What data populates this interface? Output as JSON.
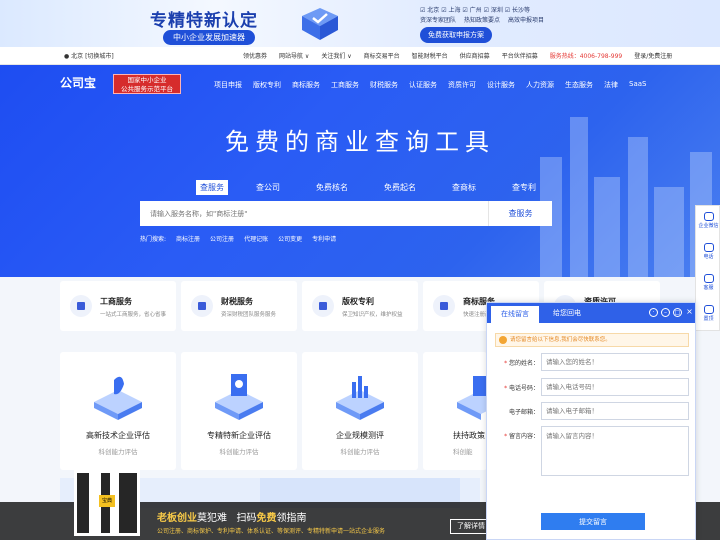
{
  "promo": {
    "title": "专精特新认定",
    "subtitle": "中小企业发展加速器",
    "cities": "☑ 北京  ☑ 上海  ☑ 广州  ☑ 深圳  ☑ 长沙等",
    "tags": [
      "资深专家团队",
      "热知政策要点",
      "高效申报项目"
    ],
    "cta": "免费获取申报方案"
  },
  "util": {
    "location": "北京 [切换城市]",
    "links": [
      "领优惠券",
      "网站导航 ∨",
      "关注我们 ∨",
      "商标交易平台",
      "智能财税平台",
      "供应商招募",
      "平台伙伴招募"
    ],
    "hotline": "服务热线：4006-798-999",
    "login": "登录/免费注册"
  },
  "header": {
    "logo": "公司宝",
    "badge_line1": "国家中小企业",
    "badge_line2": "公共服务示范平台",
    "nav": [
      "项目申报",
      "版权专利",
      "商标服务",
      "工商服务",
      "财税服务",
      "认证服务",
      "资质许可",
      "设计服务",
      "人力资源",
      "生态服务",
      "法律",
      "SaaS"
    ]
  },
  "hero": {
    "title": "免费的商业查询工具",
    "tabs": [
      "查服务",
      "查公司",
      "免费核名",
      "免费起名",
      "查商标",
      "查专利"
    ],
    "placeholder": "请输入服务名称，如\"商标注册\"",
    "search_button": "查服务",
    "hot_label": "热门搜索:",
    "hot_words": [
      "商标注册",
      "公司注册",
      "代理记账",
      "公司变更",
      "专利申请"
    ]
  },
  "services": [
    {
      "title": "工商服务",
      "sub": "一站式工商服务，省心省事"
    },
    {
      "title": "财税服务",
      "sub": "资深财税团队服务服务"
    },
    {
      "title": "版权专利",
      "sub": "保卫知识产权，维护权益"
    },
    {
      "title": "商标服务",
      "sub": "快速注册商标"
    },
    {
      "title": "资质许可",
      "sub": ""
    }
  ],
  "evaluations": [
    {
      "title": "高新技术企业评估",
      "sub": "科创能力评估"
    },
    {
      "title": "专精特新企业评估",
      "sub": "科创能力评估"
    },
    {
      "title": "企业规模测评",
      "sub": "科创能力评估"
    },
    {
      "title": "扶持政策",
      "sub": "科创能"
    }
  ],
  "bottom_bar": {
    "qr_badge": "宝典",
    "title_a": "老板创业",
    "title_b": "莫犯难",
    "title_c": "扫码",
    "title_d": "免费",
    "title_e": "领指南",
    "sub": "公司注册、商标保护、专利申请、体系认证、等保测评、专精特新申请一站式企业服务",
    "button": "了解详情"
  },
  "sidebar": [
    {
      "label": "企业微信"
    },
    {
      "label": "电话"
    },
    {
      "label": "客服"
    },
    {
      "label": "置顶"
    }
  ],
  "chat": {
    "tab_active": "在线留言",
    "tab_other": "给您回电",
    "notice": "请您留言给以下信息,我们会尽快联系您。",
    "fields": [
      {
        "label": "您的姓名：",
        "required": true,
        "placeholder": "请输入您的姓名！"
      },
      {
        "label": "电话号码：",
        "required": true,
        "placeholder": "请输入电话号码！"
      },
      {
        "label": "电子邮箱：",
        "required": false,
        "placeholder": "请输入电子邮箱！"
      }
    ],
    "message_label": "留言内容：",
    "message_placeholder": "请输入留言内容！",
    "submit": "提交留言"
  }
}
